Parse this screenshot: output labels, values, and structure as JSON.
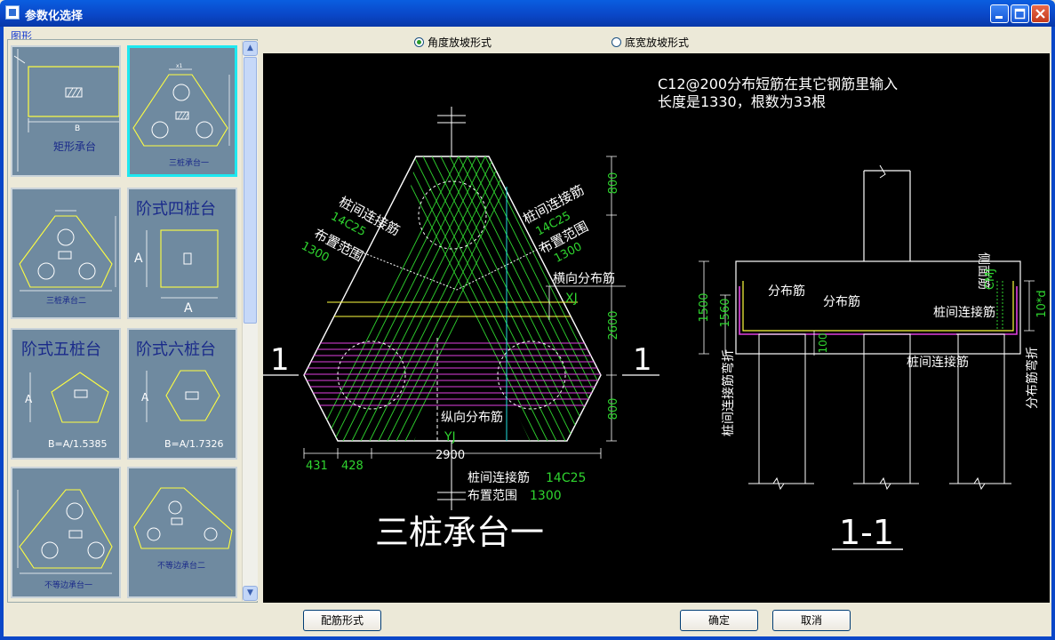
{
  "window": {
    "title": "参数化选择"
  },
  "left_panel": {
    "group_label": "图形",
    "thumbnails": [
      {
        "label": "矩形承台",
        "dim": "B"
      },
      {
        "label": "三桩承台一",
        "selected": true
      },
      {
        "label": "三桩承台二"
      },
      {
        "title": "阶式四桩台",
        "dim_a1": "A",
        "dim_a2": "A"
      },
      {
        "title": "阶式五桩台",
        "dim_a": "A",
        "formula": "B=A/1.5385"
      },
      {
        "title": "阶式六桩台",
        "dim_a": "A",
        "formula": "B=A/1.7326"
      },
      {
        "label": "不等边承台一"
      },
      {
        "label": "不等边承台二"
      }
    ]
  },
  "options": {
    "radio1": {
      "label": "角度放坡形式",
      "checked": true
    },
    "radio2": {
      "label": "底宽放坡形式",
      "checked": false
    }
  },
  "drawing": {
    "note_line1": "C12@200分布短筋在其它钢筋里输入",
    "note_line2": "长度是1330，根数为33根",
    "left_label1": "桩间连接筋",
    "left_value1": "14C25",
    "left_label2": "布置范围",
    "left_value2": "1300",
    "right_label1": "桩间连接筋",
    "right_value1": "14C25",
    "right_label2": "布置范围",
    "right_value2": "1300",
    "cross_dist": "横向分布筋",
    "xj": "XJ",
    "long_dist": "纵向分布筋",
    "yj": "YJ",
    "dim_800_top": "800",
    "dim_2600": "2600",
    "dim_800_bot": "800",
    "dim_431": "431",
    "dim_428": "428",
    "dim_2900": "2900",
    "bottom_label1": "桩间连接筋",
    "bottom_value1": "14C25",
    "bottom_label2": "布置范围",
    "bottom_value2": "1300",
    "section_mark": "1",
    "plan_title": "三桩承台一",
    "section_title": "1-1",
    "sec_dist1": "分布筋",
    "sec_dist2": "分布筋",
    "sec_side": "侧面筋",
    "sec_cmj": "CMJ",
    "sec_link1": "桩间连接筋",
    "sec_link2": "桩间连接筋",
    "sec_1500": "1500",
    "sec_1560": "1560",
    "sec_100": "100",
    "sec_10d": "10*d",
    "sec_left_vert": "桩间连接筋弯折",
    "sec_right_vert": "分布筋弯折"
  },
  "buttons": {
    "rebar": "配筋形式",
    "ok": "确定",
    "cancel": "取消"
  },
  "colors": {
    "title_bar": "#0a47c8",
    "canvas_bg": "#000000",
    "thumb_bg": "#6f8aa0",
    "selected_border": "#1ee8f0",
    "dim_green": "#2fd52f",
    "rebar_magenta": "#e040e0",
    "axis_cyan": "#20e0e0"
  }
}
